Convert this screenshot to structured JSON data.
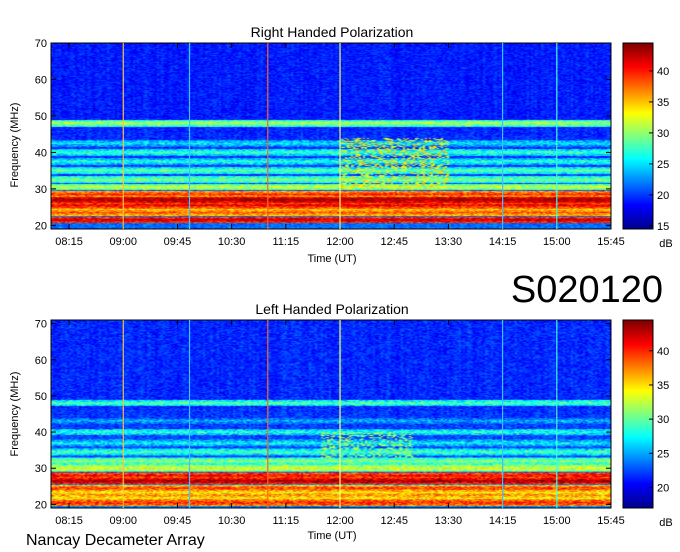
{
  "header_code": "S020120",
  "footer": "Nancay Decameter Array",
  "colors": {
    "background": "#ffffff",
    "colormap": [
      "#00008f",
      "#0000ff",
      "#0080ff",
      "#00ffff",
      "#80ff80",
      "#ffff00",
      "#ff8000",
      "#ff0000",
      "#800000"
    ]
  },
  "chart_data": [
    {
      "type": "heatmap",
      "title": "Right Handed Polarization",
      "xlabel": "Time (UT)",
      "ylabel": "Frequency (MHz)",
      "x_ticks": [
        "08:15",
        "09:00",
        "09:45",
        "10:30",
        "11:15",
        "12:00",
        "12:45",
        "13:30",
        "14:15",
        "15:00",
        "15:45"
      ],
      "x_range": [
        "08:00",
        "15:45"
      ],
      "y_range": [
        19,
        70
      ],
      "y_ticks": [
        20,
        30,
        40,
        50,
        60,
        70
      ],
      "colorbar": {
        "label": "dB",
        "range": [
          14.5,
          44.5
        ],
        "ticks": [
          15,
          20,
          25,
          30,
          35,
          40
        ]
      },
      "strong_bands_mhz": [
        {
          "freq": 21.5,
          "level": 42
        },
        {
          "freq": 23.5,
          "level": 38
        },
        {
          "freq": 25.5,
          "level": 41
        },
        {
          "freq": 27.0,
          "level": 43
        },
        {
          "freq": 28.5,
          "level": 39
        },
        {
          "freq": 30.5,
          "level": 31
        },
        {
          "freq": 32.5,
          "level": 29
        },
        {
          "freq": 35.0,
          "level": 28
        },
        {
          "freq": 37.5,
          "level": 26
        },
        {
          "freq": 40.0,
          "level": 27
        },
        {
          "freq": 42.5,
          "level": 25
        },
        {
          "freq": 48.0,
          "level": 30
        }
      ],
      "burst_regions": [
        {
          "t_start": "12:00",
          "t_end": "13:30",
          "f_low": 30,
          "f_high": 44,
          "level": 33
        }
      ],
      "vertical_lines": [
        {
          "time": "09:00",
          "color": "#ffc040"
        },
        {
          "time": "09:55",
          "color": "#40c0ff"
        },
        {
          "time": "11:00",
          "color": "#ff6020"
        },
        {
          "time": "12:00",
          "color": "#ffff60"
        },
        {
          "time": "14:15",
          "color": "#40c0ff"
        },
        {
          "time": "15:00",
          "color": "#40ffe0"
        }
      ]
    },
    {
      "type": "heatmap",
      "title": "Left Handed Polarization",
      "xlabel": "Time (UT)",
      "ylabel": "Frequency (MHz)",
      "x_ticks": [
        "08:15",
        "09:00",
        "09:45",
        "10:30",
        "11:15",
        "12:00",
        "12:45",
        "13:30",
        "14:15",
        "15:00",
        "15:45"
      ],
      "x_range": [
        "08:00",
        "15:45"
      ],
      "y_range": [
        19,
        71
      ],
      "y_ticks": [
        20,
        30,
        40,
        50,
        60,
        70
      ],
      "colorbar": {
        "label": "dB",
        "range": [
          17,
          44.5
        ],
        "ticks": [
          20,
          25,
          30,
          35,
          40
        ]
      },
      "strong_bands_mhz": [
        {
          "freq": 20.5,
          "level": 40
        },
        {
          "freq": 22.5,
          "level": 37
        },
        {
          "freq": 24.5,
          "level": 39
        },
        {
          "freq": 26.5,
          "level": 43
        },
        {
          "freq": 28.0,
          "level": 41
        },
        {
          "freq": 30.0,
          "level": 33
        },
        {
          "freq": 32.0,
          "level": 31
        },
        {
          "freq": 34.5,
          "level": 29
        },
        {
          "freq": 37.0,
          "level": 27
        },
        {
          "freq": 40.0,
          "level": 28
        },
        {
          "freq": 43.0,
          "level": 25
        },
        {
          "freq": 48.0,
          "level": 29
        }
      ],
      "burst_regions": [
        {
          "t_start": "11:45",
          "t_end": "13:00",
          "f_low": 33,
          "f_high": 40,
          "level": 31
        }
      ],
      "vertical_lines": [
        {
          "time": "09:00",
          "color": "#ffc040"
        },
        {
          "time": "09:55",
          "color": "#40c0ff"
        },
        {
          "time": "11:00",
          "color": "#ff6020"
        },
        {
          "time": "12:00",
          "color": "#ffff60"
        },
        {
          "time": "14:15",
          "color": "#40c0ff"
        },
        {
          "time": "15:00",
          "color": "#40ffe0"
        }
      ]
    }
  ]
}
